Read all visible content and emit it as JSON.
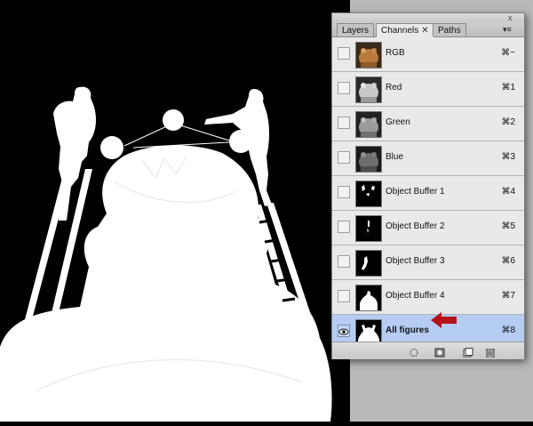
{
  "panel": {
    "close_glyph": "x",
    "menu_glyph": "▾≡",
    "tabs": [
      {
        "label": "Layers",
        "active": false
      },
      {
        "label": "Channels",
        "active": true,
        "close": "✕"
      },
      {
        "label": "Paths",
        "active": false
      }
    ],
    "channels": [
      {
        "name": "RGB",
        "shortcut": "⌘~",
        "thumb": "color",
        "visible": false,
        "selected": false
      },
      {
        "name": "Red",
        "shortcut": "⌘1",
        "thumb": "gray-light",
        "visible": false,
        "selected": false
      },
      {
        "name": "Green",
        "shortcut": "⌘2",
        "thumb": "gray-mid",
        "visible": false,
        "selected": false
      },
      {
        "name": "Blue",
        "shortcut": "⌘3",
        "thumb": "gray-dark",
        "visible": false,
        "selected": false
      },
      {
        "name": "Object Buffer 1",
        "shortcut": "⌘4",
        "thumb": "mask",
        "visible": false,
        "selected": false
      },
      {
        "name": "Object Buffer 2",
        "shortcut": "⌘5",
        "thumb": "mask",
        "visible": false,
        "selected": false
      },
      {
        "name": "Object Buffer 3",
        "shortcut": "⌘6",
        "thumb": "mask",
        "visible": false,
        "selected": false
      },
      {
        "name": "Object Buffer 4",
        "shortcut": "⌘7",
        "thumb": "mask",
        "visible": false,
        "selected": false
      },
      {
        "name": "All figures",
        "shortcut": "⌘8",
        "thumb": "mask",
        "visible": true,
        "selected": true
      }
    ],
    "footer_icons": [
      "load-selection-icon",
      "save-selection-icon",
      "new-channel-icon",
      "delete-channel-icon"
    ]
  },
  "colors": {
    "selection": "#b5cdf2",
    "arrow": "#b5121b",
    "canvas_bg": "#000000",
    "mask_white": "#ffffff"
  }
}
